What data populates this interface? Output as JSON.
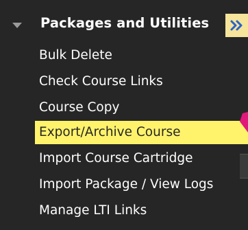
{
  "section": {
    "title": "Packages and Utilities",
    "expand_label": "»"
  },
  "menu": {
    "items": [
      {
        "label": "Bulk Delete"
      },
      {
        "label": "Check Course Links"
      },
      {
        "label": "Course Copy"
      },
      {
        "label": "Export/Archive Course",
        "active": true
      },
      {
        "label": "Import Course Cartridge"
      },
      {
        "label": "Import Package / View Logs"
      },
      {
        "label": "Manage LTI Links"
      }
    ]
  },
  "colors": {
    "panel_background": "#262626",
    "text": "#ffffff",
    "active_highlight": "#fff36b",
    "expand_button_background": "#f6e59a",
    "expand_button_glyph": "#2a63c9",
    "annotation_arrow": "#e0187a"
  },
  "icons": {
    "section_toggle": "caret-down-icon",
    "expand": "double-chevron-right-icon",
    "annotation": "arrow-icon"
  }
}
